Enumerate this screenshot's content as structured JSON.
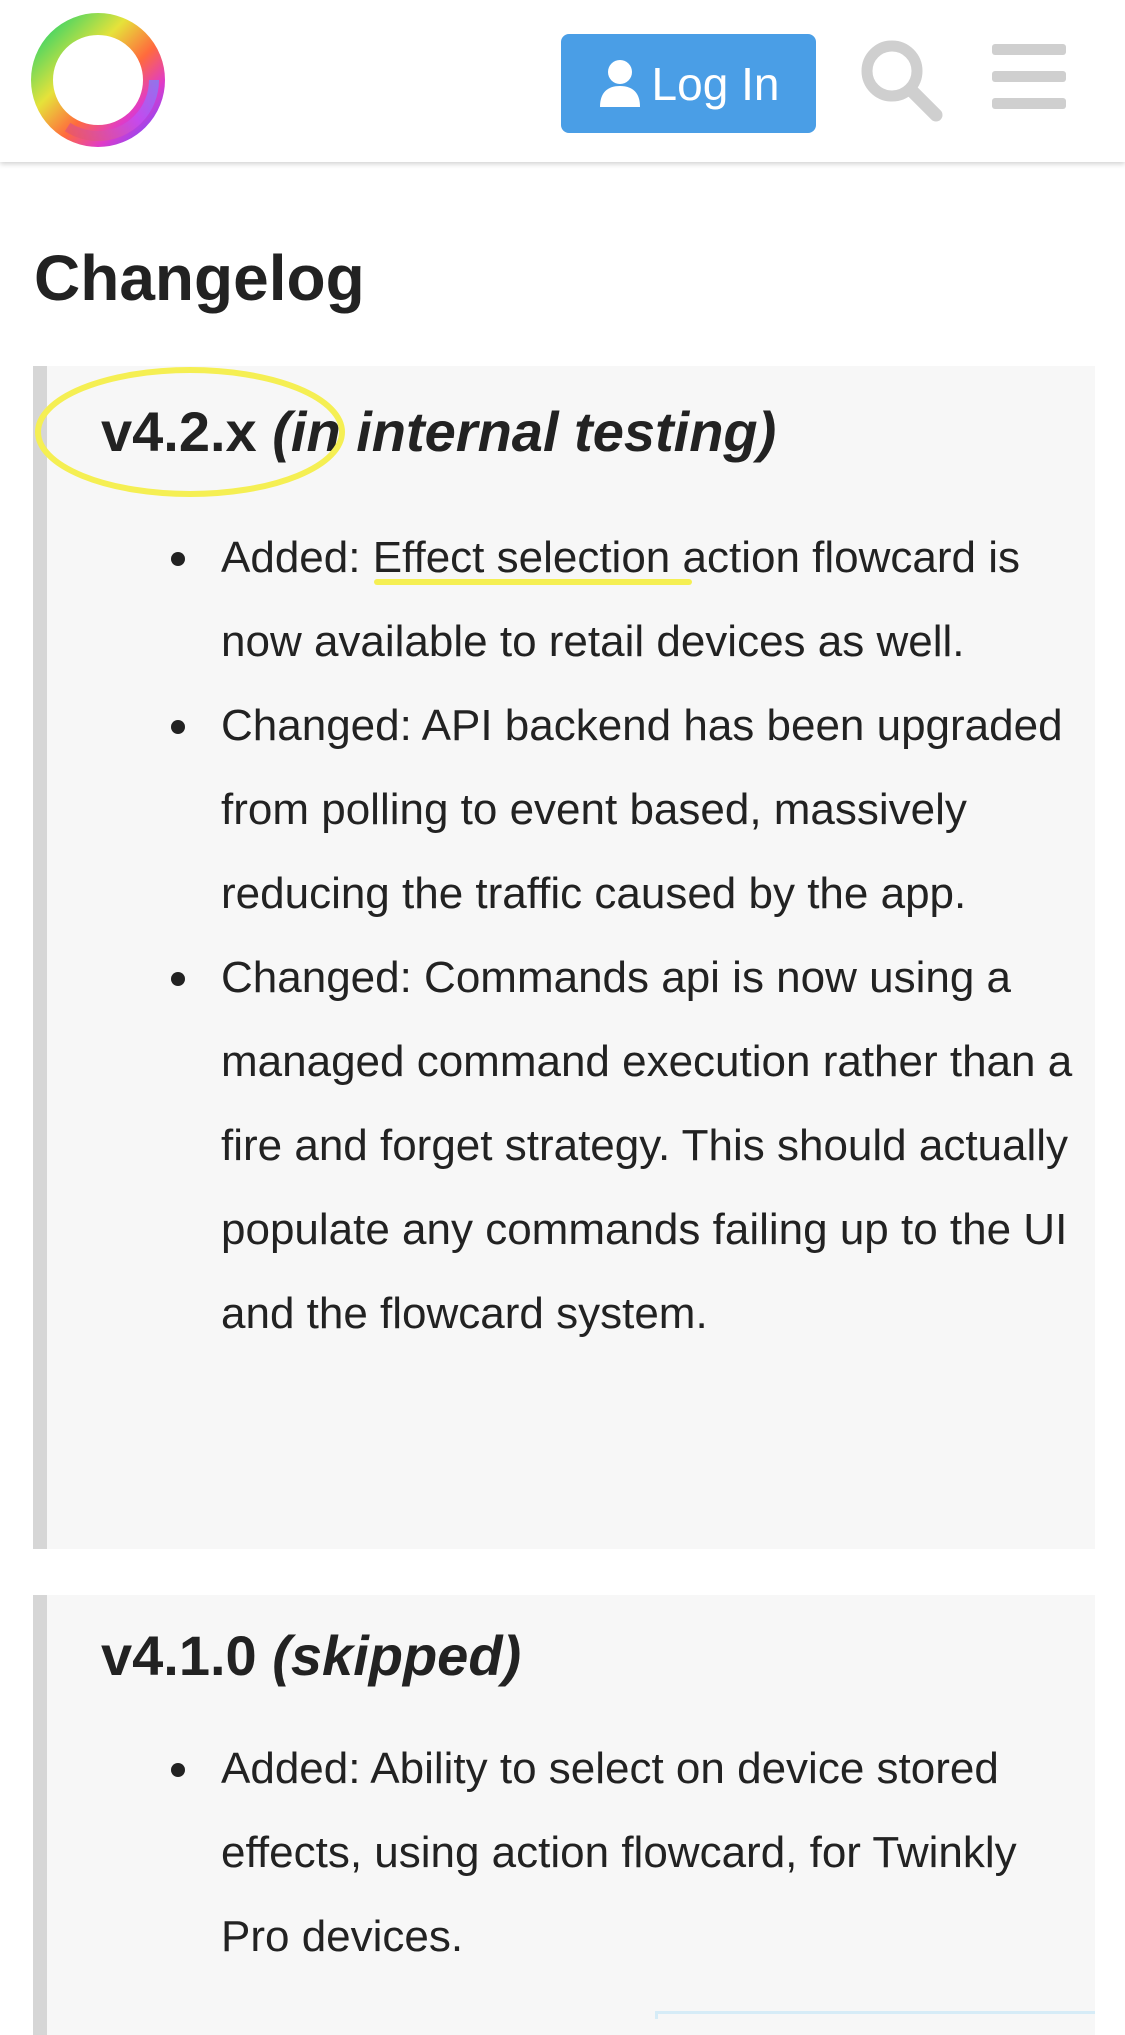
{
  "header": {
    "login_label": "Log In",
    "logo_icon": "rainbow-ring-logo",
    "user_icon": "user-icon",
    "search_icon": "search-icon",
    "menu_icon": "hamburger-menu-icon",
    "accent_color": "#4a9ee6"
  },
  "page": {
    "title": "Changelog"
  },
  "sections": [
    {
      "version": "v4.2.x",
      "status": "(in internal testing)",
      "items": [
        {
          "prefix": "Added: ",
          "link": "Effect selection",
          "text": " action flowcard is now available to retail devices as well."
        },
        {
          "text": "Changed: API backend has been upgraded from polling to event based, massively reducing the traffic caused by the app."
        },
        {
          "text": "Changed: Commands api is now using a managed command execution rather than a fire and forget strategy. This should actually populate any commands failing up to the UI and the flowcard system."
        }
      ]
    },
    {
      "version": "v4.1.0",
      "status": "(skipped)",
      "items": [
        {
          "text": "Added: Ability to select on device stored effects, using action flowcard, for Twinkly Pro devices."
        }
      ]
    }
  ],
  "annotations": {
    "highlight_color": "#f5ef53"
  }
}
